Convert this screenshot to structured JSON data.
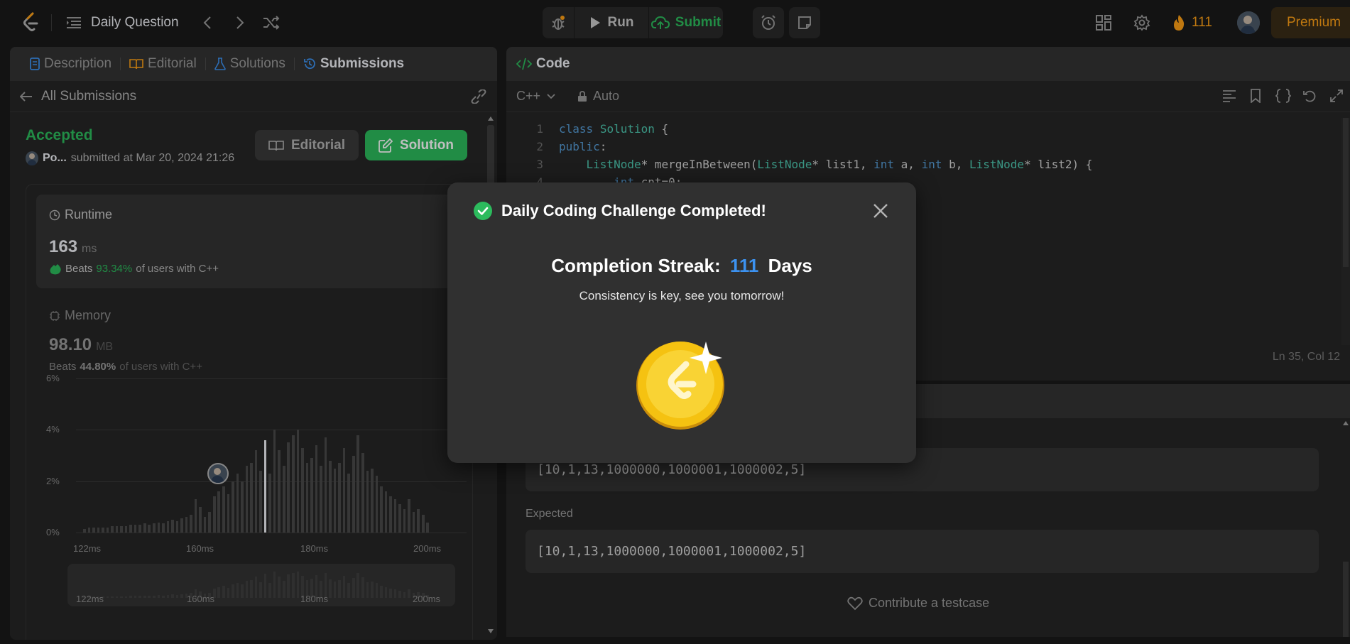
{
  "topbar": {
    "problem_list_label": "Daily Question",
    "run_label": "Run",
    "submit_label": "Submit",
    "streak_count": "111",
    "premium_label": "Premium"
  },
  "left_panel": {
    "tabs": [
      {
        "label": "Description"
      },
      {
        "label": "Editorial"
      },
      {
        "label": "Solutions"
      },
      {
        "label": "Submissions"
      }
    ],
    "back_label": "All Submissions",
    "status": "Accepted",
    "user": "Po...",
    "submitted_text": "submitted at Mar 20, 2024 21:26",
    "editorial_button": "Editorial",
    "solution_button": "Solution",
    "runtime": {
      "title": "Runtime",
      "value": "163",
      "unit": "ms",
      "beats_prefix": "Beats",
      "beats_value": "93.34%",
      "beats_suffix": "of users with C++"
    },
    "memory": {
      "title": "Memory",
      "value": "98.10",
      "unit": "MB",
      "beats_prefix": "Beats",
      "beats_value": "44.80%",
      "beats_suffix": "of users with C++"
    }
  },
  "chart_data": {
    "type": "bar",
    "title": "",
    "xlabel": "",
    "ylabel": "",
    "y_ticks": [
      "6%",
      "4%",
      "2%",
      "0%"
    ],
    "x_ticks": [
      "122ms",
      "160ms",
      "180ms",
      "200ms"
    ],
    "ylim": [
      0,
      6
    ],
    "xlim": [
      122,
      200
    ],
    "highlight_x": 163,
    "values": [
      0.15,
      0.2,
      0.2,
      0.2,
      0.2,
      0.2,
      0.25,
      0.25,
      0.25,
      0.25,
      0.3,
      0.3,
      0.3,
      0.35,
      0.3,
      0.35,
      0.4,
      0.35,
      0.45,
      0.5,
      0.45,
      0.55,
      0.6,
      0.7,
      1.3,
      1.0,
      0.6,
      0.8,
      1.4,
      1.6,
      1.8,
      1.5,
      2.0,
      2.3,
      2.0,
      2.6,
      2.7,
      3.2,
      2.4,
      3.6,
      2.3,
      4.0,
      3.2,
      2.6,
      3.5,
      3.8,
      4.0,
      3.3,
      2.7,
      2.9,
      3.4,
      2.6,
      3.7,
      2.8,
      2.5,
      2.7,
      3.3,
      2.3,
      3.0,
      3.8,
      3.1,
      2.4,
      2.5,
      2.2,
      1.8,
      1.6,
      1.4,
      1.3,
      1.1,
      0.9,
      1.3,
      0.8,
      0.9,
      0.7,
      0.4
    ],
    "mini_x_ticks": [
      "122ms",
      "160ms",
      "180ms",
      "200ms"
    ]
  },
  "code_panel": {
    "title": "Code",
    "language": "C++",
    "auto_label": "Auto",
    "lines": [
      {
        "num": "1",
        "text": "class Solution {"
      },
      {
        "num": "2",
        "text": "public:"
      },
      {
        "num": "3",
        "text": "    ListNode* mergeInBetween(ListNode* list1, int a, int b, ListNode* list2) {"
      },
      {
        "num": "4",
        "text": "        int cnt=0;"
      }
    ],
    "cursor_pos": "Ln 35, Col 12"
  },
  "testcase": {
    "output_value": "[10,1,13,1000000,1000001,1000002,5]",
    "expected_label": "Expected",
    "expected_value": "[10,1,13,1000000,1000001,1000002,5]",
    "contribute_label": "Contribute a testcase"
  },
  "modal": {
    "title": "Daily Coding Challenge Completed!",
    "streak_label": "Completion Streak:",
    "streak_value": "111",
    "streak_unit": "Days",
    "message": "Consistency is key, see you tomorrow!"
  },
  "colors": {
    "accepted": "#2cbb5d",
    "accent_blue": "#3c92f0",
    "premium": "#ffa116"
  }
}
